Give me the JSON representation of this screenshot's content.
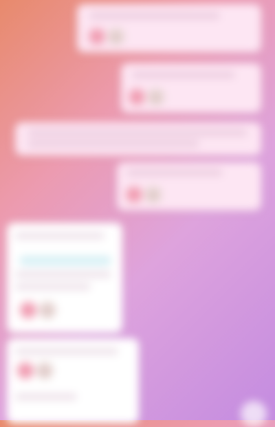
{
  "chat": {
    "messages": [
      {
        "id": "m1",
        "text": "",
        "reactions": [
          {
            "icon": "heart-icon",
            "glyph": "♥"
          },
          {
            "icon": "smile-icon",
            "glyph": "☺"
          }
        ]
      },
      {
        "id": "m2",
        "text": "",
        "reactions": [
          {
            "icon": "heart-icon",
            "glyph": "♥"
          },
          {
            "icon": "smile-icon",
            "glyph": "☺"
          }
        ]
      },
      {
        "id": "m3",
        "text": ""
      },
      {
        "id": "m4",
        "text": "",
        "reactions": [
          {
            "icon": "heart-icon",
            "glyph": "♥"
          },
          {
            "icon": "smile-icon",
            "glyph": "☺"
          }
        ]
      },
      {
        "id": "m5",
        "text": "",
        "reactions": [
          {
            "icon": "heart-icon",
            "glyph": "♥"
          },
          {
            "icon": "smile-icon",
            "glyph": "☺"
          }
        ]
      },
      {
        "id": "m6",
        "text": "",
        "reactions": [
          {
            "icon": "heart-icon",
            "glyph": "♥"
          },
          {
            "icon": "smile-icon",
            "glyph": "☺"
          }
        ]
      }
    ]
  },
  "colors": {
    "background_start": "#e88a6c",
    "background_end": "#c48ce0",
    "bubble_pink": "#fde6f3",
    "bubble_white": "#ffffff",
    "link_highlight": "#d7f0f5"
  }
}
